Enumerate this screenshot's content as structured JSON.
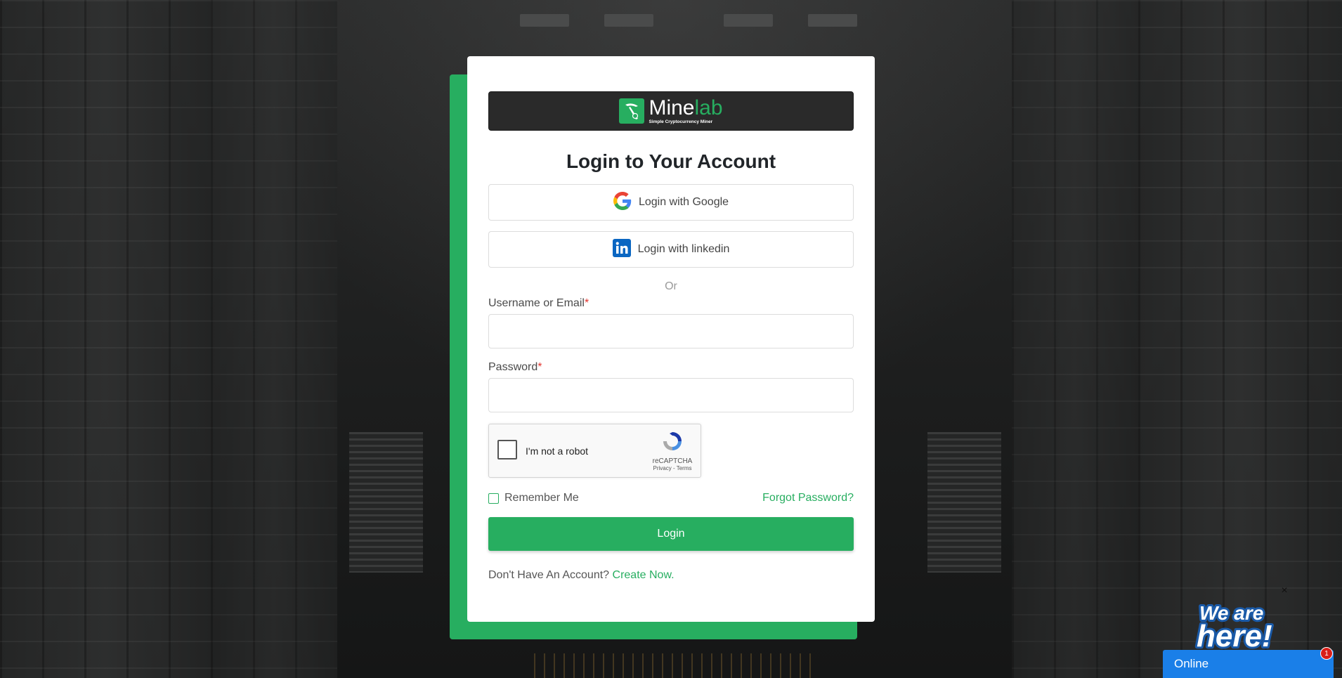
{
  "brand": {
    "name_part1": "Mine",
    "name_part2": "lab",
    "tagline": "Simple Cryptocurrency Miner",
    "accent_color": "#27ae60"
  },
  "login": {
    "title": "Login to Your Account",
    "google_label": "Login with Google",
    "linkedin_label": "Login with linkedin",
    "or_text": "Or",
    "username_label": "Username or Email",
    "password_label": "Password",
    "required_mark": "*",
    "username_value": "",
    "password_value": "",
    "recaptcha": {
      "checkbox_label": "I'm not a robot",
      "brand": "reCAPTCHA",
      "links": "Privacy - Terms"
    },
    "remember_label": "Remember Me",
    "forgot_label": "Forgot Password?",
    "submit_label": "Login",
    "signup_prompt": "Don't Have An Account?",
    "signup_link": "Create Now."
  },
  "chat": {
    "close_glyph": "×",
    "badge_text": "We are here!",
    "status": "Online",
    "unread_count": "1"
  }
}
